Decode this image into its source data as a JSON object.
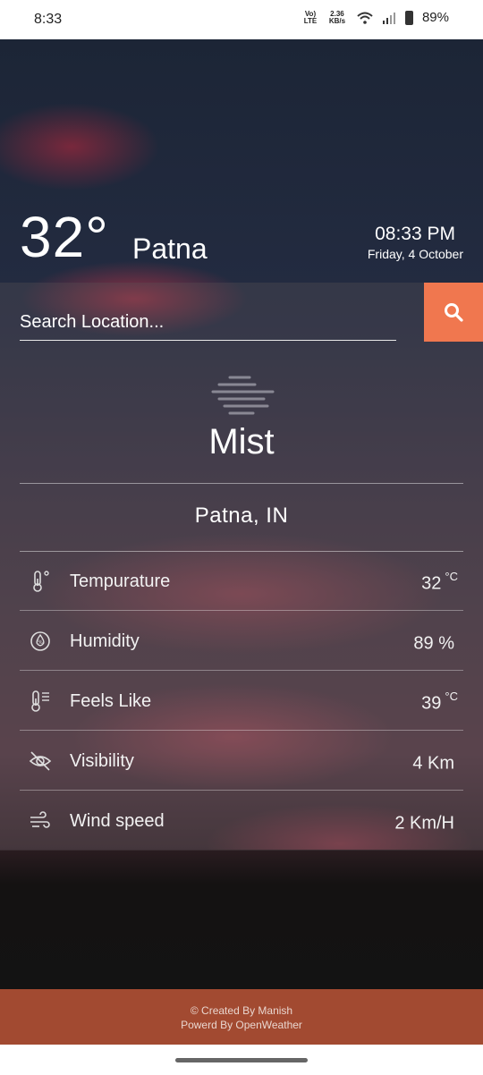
{
  "status_bar": {
    "time": "8:33",
    "network_type": "Vo) LTE",
    "speed": "2.36 KB/s",
    "battery": "89%"
  },
  "header": {
    "temperature": "32°",
    "city": "Patna",
    "time": "08:33  PM",
    "date": "Friday, 4 October"
  },
  "search": {
    "placeholder": "Search Location...",
    "button_icon": "search-icon",
    "button_color": "#f0774f"
  },
  "weather": {
    "icon": "mist-icon",
    "condition": "Mist",
    "location": "Patna,  IN"
  },
  "details": [
    {
      "icon": "thermometer-icon",
      "label": "Tempurature",
      "value": "32",
      "unit": "°C"
    },
    {
      "icon": "humidity-drop-icon",
      "label": "Humidity",
      "value": "89 %",
      "unit": ""
    },
    {
      "icon": "feels-like-thermometer-icon",
      "label": "Feels Like",
      "value": "39",
      "unit": "°C"
    },
    {
      "icon": "visibility-off-icon",
      "label": "Visibility",
      "value": "4 Km",
      "unit": ""
    },
    {
      "icon": "wind-icon",
      "label": "Wind speed",
      "value": "2 Km/H",
      "unit": ""
    }
  ],
  "footer": {
    "line1": "© Created By Manish",
    "line2": "Powerd By OpenWeather",
    "color": "#a24a31"
  }
}
